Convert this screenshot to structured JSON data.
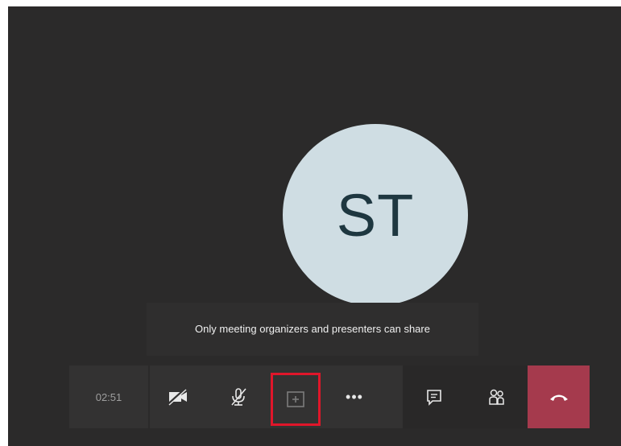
{
  "participant": {
    "initials": "ST"
  },
  "tooltip": {
    "text": "Only meeting organizers and presenters can share"
  },
  "controls": {
    "timer": "02:51",
    "buttons": [
      {
        "name": "camera-off",
        "icon": "camera-off-icon"
      },
      {
        "name": "mic-off",
        "icon": "mic-off-icon"
      },
      {
        "name": "share",
        "icon": "share-screen-icon",
        "highlighted": true
      },
      {
        "name": "more",
        "icon": "more-icon",
        "label": "•••"
      },
      {
        "name": "chat",
        "icon": "chat-icon"
      },
      {
        "name": "participants",
        "icon": "participants-icon"
      },
      {
        "name": "hang-up",
        "icon": "hang-up-icon"
      }
    ]
  },
  "colors": {
    "background": "#2b2a2a",
    "avatar": "#cfdde3",
    "highlight": "#e0162a",
    "hangup": "#a53a4d"
  }
}
